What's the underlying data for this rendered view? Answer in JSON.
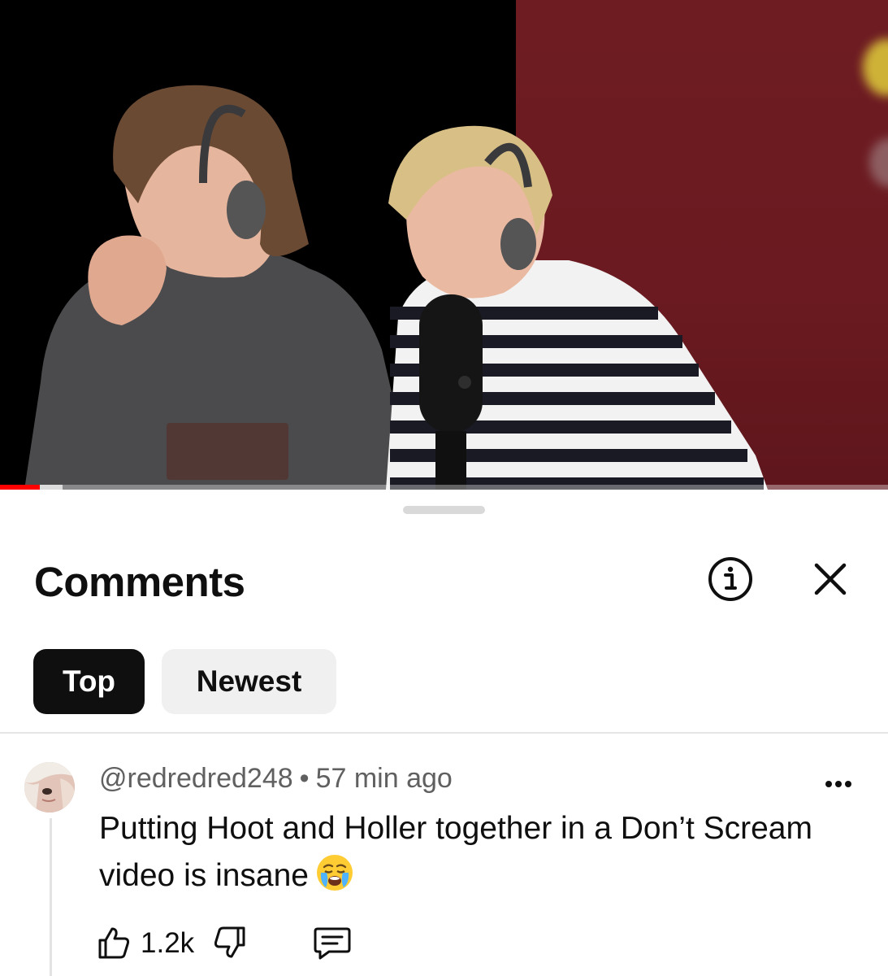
{
  "video": {
    "progress_percent": 4.5,
    "buffered_percent": 7
  },
  "panel": {
    "title": "Comments",
    "info_icon": "info-icon",
    "close_icon": "close-icon"
  },
  "sort": {
    "tabs": [
      {
        "label": "Top",
        "selected": true
      },
      {
        "label": "Newest",
        "selected": false
      }
    ]
  },
  "comment": {
    "author": "@redredred248",
    "separator": "•",
    "time": "57 min ago",
    "text": "Putting Hoot and Holler together in a Don’t Scream video is insane",
    "emoji": "crying-face-emoji",
    "likes": "1.2k",
    "more_icon": "more-vertical-icon",
    "like_icon": "thumbs-up-icon",
    "dislike_icon": "thumbs-down-icon",
    "reply_icon": "reply-icon"
  },
  "colors": {
    "accent": "#ff0000",
    "selected_chip": "#0f0f0f",
    "chip_bg": "#f0f0f0",
    "secondary_text": "#606060"
  }
}
